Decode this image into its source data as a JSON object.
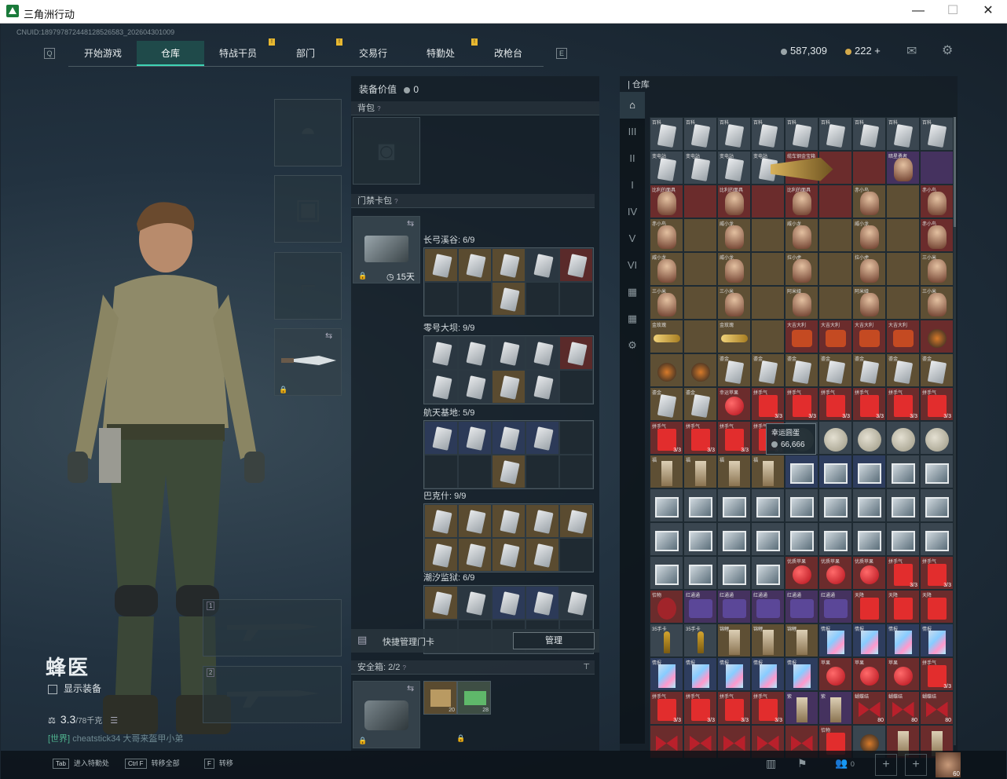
{
  "window": {
    "title": "三角洲行动",
    "minimize": "—",
    "maximize": "☐",
    "close": "✕"
  },
  "uid": "CNUID:189797872448128526583_202604301009",
  "tabs": [
    {
      "label": "开始游戏",
      "warn": false
    },
    {
      "label": "仓库",
      "warn": false
    },
    {
      "label": "特战干员",
      "warn": true
    },
    {
      "label": "部门",
      "warn": true
    },
    {
      "label": "交易行",
      "warn": false
    },
    {
      "label": "特勤处",
      "warn": true
    },
    {
      "label": "改枪台",
      "warn": false
    }
  ],
  "currency": {
    "coins": "587,309",
    "premium": "222 +",
    "coin_color": "#9aa4a8",
    "premium_color": "#d4a94a"
  },
  "operator": {
    "name": "蜂医",
    "show_equipment": "显示装备",
    "weight": "3.3",
    "weight_max": "/78千克"
  },
  "chat": {
    "channel": "[世界]",
    "user": "cheatstick34",
    "message": "大哥来盔甲小弟"
  },
  "equipment": {
    "value_label": "装备价值",
    "value": "0",
    "backpack_label": "背包",
    "card_pack_label": "门禁卡包",
    "card_pack_days": "15天",
    "safe_box_label": "安全箱",
    "safe_box_count": "2/2",
    "quick_manage_label": "快捷管理门卡",
    "manage_button": "管理",
    "safe_item_counts": [
      "20",
      "28"
    ]
  },
  "card_groups": [
    {
      "title": "长弓溪谷: 6/9",
      "tints": [
        "gold",
        "gold",
        "gold",
        "grey",
        "red",
        "",
        "",
        "gold",
        "",
        ""
      ]
    },
    {
      "title": "零号大坝: 9/9",
      "tints": [
        "grey",
        "grey",
        "grey",
        "grey",
        "red",
        "grey",
        "grey",
        "gold",
        "grey",
        ""
      ]
    },
    {
      "title": "航天基地: 5/9",
      "tints": [
        "blue",
        "blue",
        "blue",
        "blue",
        "",
        "",
        "",
        "gold",
        "",
        ""
      ]
    },
    {
      "title": "巴克什: 9/9",
      "tints": [
        "gold",
        "gold",
        "gold",
        "gold",
        "gold",
        "gold",
        "gold",
        "gold",
        "gold",
        ""
      ]
    },
    {
      "title": "潮汐监狱: 6/9",
      "tints": [
        "gold",
        "grey",
        "blue",
        "blue",
        "grey",
        "",
        "",
        "",
        "",
        ""
      ]
    }
  ],
  "warehouse": {
    "label": "仓库",
    "tooltip_title": "幸运圆蛋",
    "tooltip_value": "66,666",
    "sidebar": [
      "⌂",
      "III",
      "II",
      "I",
      "IV",
      "V",
      "VI",
      "▦",
      "▦",
      "⚙",
      "",
      "",
      ""
    ],
    "items": [
      {
        "tint": "grey",
        "shape": "card",
        "label": "百科"
      },
      {
        "tint": "grey",
        "shape": "card",
        "label": "百科"
      },
      {
        "tint": "grey",
        "shape": "card",
        "label": "百科"
      },
      {
        "tint": "grey",
        "shape": "card",
        "label": "百科"
      },
      {
        "tint": "grey",
        "shape": "card",
        "label": "百科"
      },
      {
        "tint": "grey",
        "shape": "card",
        "label": "百科"
      },
      {
        "tint": "grey",
        "shape": "card",
        "label": "百科"
      },
      {
        "tint": "grey",
        "shape": "card",
        "label": "百科"
      },
      {
        "tint": "grey",
        "shape": "card",
        "label": "百科"
      },
      {
        "tint": "grey",
        "shape": "card",
        "label": "变电站"
      },
      {
        "tint": "grey",
        "shape": "card",
        "label": "变电站"
      },
      {
        "tint": "grey",
        "shape": "card",
        "label": "变电站"
      },
      {
        "tint": "grey",
        "shape": "card",
        "label": "变电站"
      },
      {
        "tint": "red",
        "shape": "wide",
        "label": "缆车钢金宝箱"
      },
      {
        "tint": "red",
        "shape": "",
        "label": ""
      },
      {
        "tint": "red",
        "shape": "",
        "label": ""
      },
      {
        "tint": "purple",
        "shape": "doll",
        "label": "暗星勇者"
      },
      {
        "tint": "purple",
        "shape": "",
        "label": ""
      },
      {
        "tint": "red",
        "shape": "doll",
        "label": "比利的面具"
      },
      {
        "tint": "red",
        "shape": "",
        "label": ""
      },
      {
        "tint": "red",
        "shape": "doll",
        "label": "比利的面具"
      },
      {
        "tint": "red",
        "shape": "",
        "label": ""
      },
      {
        "tint": "red",
        "shape": "doll",
        "label": "比利的面具"
      },
      {
        "tint": "red",
        "shape": "",
        "label": ""
      },
      {
        "tint": "gold",
        "shape": "doll",
        "label": "赤小鸟"
      },
      {
        "tint": "gold",
        "shape": "",
        "label": ""
      },
      {
        "tint": "red",
        "shape": "doll",
        "label": "赤小鸟"
      },
      {
        "tint": "gold",
        "shape": "doll",
        "label": "赤小鸟"
      },
      {
        "tint": "gold",
        "shape": "",
        "label": ""
      },
      {
        "tint": "gold",
        "shape": "doll",
        "label": "威小龙"
      },
      {
        "tint": "gold",
        "shape": "",
        "label": ""
      },
      {
        "tint": "gold",
        "shape": "doll",
        "label": "威小龙"
      },
      {
        "tint": "gold",
        "shape": "",
        "label": ""
      },
      {
        "tint": "gold",
        "shape": "doll",
        "label": "威小龙"
      },
      {
        "tint": "gold",
        "shape": "",
        "label": ""
      },
      {
        "tint": "red",
        "shape": "doll",
        "label": "赤小鸟"
      },
      {
        "tint": "gold",
        "shape": "doll",
        "label": "威小龙"
      },
      {
        "tint": "gold",
        "shape": "",
        "label": ""
      },
      {
        "tint": "gold",
        "shape": "doll",
        "label": "威小龙"
      },
      {
        "tint": "gold",
        "shape": "",
        "label": ""
      },
      {
        "tint": "gold",
        "shape": "doll",
        "label": "拉小虎"
      },
      {
        "tint": "gold",
        "shape": "",
        "label": ""
      },
      {
        "tint": "gold",
        "shape": "doll",
        "label": "拉小虎"
      },
      {
        "tint": "gold",
        "shape": "",
        "label": ""
      },
      {
        "tint": "gold",
        "shape": "doll",
        "label": "三小米"
      },
      {
        "tint": "gold",
        "shape": "doll",
        "label": "三小米"
      },
      {
        "tint": "gold",
        "shape": "",
        "label": ""
      },
      {
        "tint": "gold",
        "shape": "doll",
        "label": "三小米"
      },
      {
        "tint": "gold",
        "shape": "",
        "label": ""
      },
      {
        "tint": "gold",
        "shape": "doll",
        "label": "阿米娅"
      },
      {
        "tint": "gold",
        "shape": "",
        "label": ""
      },
      {
        "tint": "gold",
        "shape": "doll",
        "label": "阿米娅"
      },
      {
        "tint": "gold",
        "shape": "",
        "label": ""
      },
      {
        "tint": "gold",
        "shape": "doll",
        "label": "三小米"
      },
      {
        "tint": "gold",
        "shape": "gold",
        "label": "金玫瑰"
      },
      {
        "tint": "gold",
        "shape": "",
        "label": ""
      },
      {
        "tint": "gold",
        "shape": "gold",
        "label": "金玫瑰"
      },
      {
        "tint": "gold",
        "shape": "",
        "label": ""
      },
      {
        "tint": "red",
        "shape": "bag",
        "label": "大吉大利"
      },
      {
        "tint": "red",
        "shape": "bag",
        "label": "大吉大利"
      },
      {
        "tint": "red",
        "shape": "bag",
        "label": "大吉大利"
      },
      {
        "tint": "red",
        "shape": "bag",
        "label": "大吉大利"
      },
      {
        "tint": "red",
        "shape": "dark",
        "label": ""
      },
      {
        "tint": "gold",
        "shape": "dark",
        "label": ""
      },
      {
        "tint": "gold",
        "shape": "dark",
        "label": ""
      },
      {
        "tint": "gold",
        "shape": "card",
        "label": "鎏金"
      },
      {
        "tint": "gold",
        "shape": "card",
        "label": "鎏金"
      },
      {
        "tint": "gold",
        "shape": "card",
        "label": "鎏金"
      },
      {
        "tint": "gold",
        "shape": "card",
        "label": "鎏金"
      },
      {
        "tint": "gold",
        "shape": "card",
        "label": "鎏金"
      },
      {
        "tint": "gold",
        "shape": "card",
        "label": "鎏金"
      },
      {
        "tint": "gold",
        "shape": "card",
        "label": "鎏金"
      },
      {
        "tint": "gold",
        "shape": "card",
        "label": "鎏金"
      },
      {
        "tint": "gold",
        "shape": "card",
        "label": "鎏金"
      },
      {
        "tint": "red",
        "shape": "apple",
        "label": "幸运苹果"
      },
      {
        "tint": "red",
        "shape": "env",
        "label": "拼手气",
        "count": "3/3"
      },
      {
        "tint": "red",
        "shape": "env",
        "label": "拼手气",
        "count": "3/3"
      },
      {
        "tint": "red",
        "shape": "env",
        "label": "拼手气",
        "count": "3/3"
      },
      {
        "tint": "red",
        "shape": "env",
        "label": "拼手气",
        "count": "3/3"
      },
      {
        "tint": "red",
        "shape": "env",
        "label": "拼手气",
        "count": "3/3"
      },
      {
        "tint": "red",
        "shape": "env",
        "label": "拼手气",
        "count": "3/3"
      },
      {
        "tint": "red",
        "shape": "env",
        "label": "拼手气",
        "count": "3/3"
      },
      {
        "tint": "red",
        "shape": "env",
        "label": "拼手气",
        "count": "3/3"
      },
      {
        "tint": "red",
        "shape": "env",
        "label": "拼手气",
        "count": "3/3"
      },
      {
        "tint": "red",
        "shape": "env",
        "label": "拼手气",
        "count": "3/3"
      },
      {
        "tint": "grey",
        "shape": "moon",
        "label": ""
      },
      {
        "tint": "grey",
        "shape": "moon",
        "label": ""
      },
      {
        "tint": "grey",
        "shape": "moon",
        "label": ""
      },
      {
        "tint": "grey",
        "shape": "moon",
        "label": ""
      },
      {
        "tint": "grey",
        "shape": "moon",
        "label": ""
      },
      {
        "tint": "gold",
        "shape": "strip",
        "label": "福"
      },
      {
        "tint": "gold",
        "shape": "strip",
        "label": "福"
      },
      {
        "tint": "gold",
        "shape": "strip",
        "label": "福"
      },
      {
        "tint": "gold",
        "shape": "strip",
        "label": "福"
      },
      {
        "tint": "blue",
        "shape": "photo",
        "label": ""
      },
      {
        "tint": "blue",
        "shape": "photo",
        "label": ""
      },
      {
        "tint": "blue",
        "shape": "photo",
        "label": ""
      },
      {
        "tint": "grey",
        "shape": "photo",
        "label": ""
      },
      {
        "tint": "grey",
        "shape": "photo",
        "label": ""
      },
      {
        "tint": "grey",
        "shape": "photo",
        "label": ""
      },
      {
        "tint": "grey",
        "shape": "photo",
        "label": ""
      },
      {
        "tint": "grey",
        "shape": "photo",
        "label": ""
      },
      {
        "tint": "grey",
        "shape": "photo",
        "label": ""
      },
      {
        "tint": "grey",
        "shape": "photo",
        "label": ""
      },
      {
        "tint": "grey",
        "shape": "photo",
        "label": ""
      },
      {
        "tint": "grey",
        "shape": "photo",
        "label": ""
      },
      {
        "tint": "grey",
        "shape": "photo",
        "label": ""
      },
      {
        "tint": "grey",
        "shape": "photo",
        "label": ""
      },
      {
        "tint": "grey",
        "shape": "photo",
        "label": ""
      },
      {
        "tint": "grey",
        "shape": "photo",
        "label": ""
      },
      {
        "tint": "grey",
        "shape": "photo",
        "label": ""
      },
      {
        "tint": "grey",
        "shape": "photo",
        "label": ""
      },
      {
        "tint": "grey",
        "shape": "photo",
        "label": ""
      },
      {
        "tint": "grey",
        "shape": "photo",
        "label": ""
      },
      {
        "tint": "grey",
        "shape": "photo",
        "label": ""
      },
      {
        "tint": "grey",
        "shape": "photo",
        "label": ""
      },
      {
        "tint": "grey",
        "shape": "photo",
        "label": ""
      },
      {
        "tint": "grey",
        "shape": "photo",
        "label": ""
      },
      {
        "tint": "grey",
        "shape": "photo",
        "label": ""
      },
      {
        "tint": "grey",
        "shape": "photo",
        "label": ""
      },
      {
        "tint": "grey",
        "shape": "photo",
        "label": ""
      },
      {
        "tint": "red",
        "shape": "apple",
        "label": "优质苹果"
      },
      {
        "tint": "red",
        "shape": "apple",
        "label": "优质苹果"
      },
      {
        "tint": "red",
        "shape": "apple",
        "label": "优质苹果"
      },
      {
        "tint": "red",
        "shape": "env",
        "label": "拼手气",
        "count": "3/3"
      },
      {
        "tint": "red",
        "shape": "env",
        "label": "拼手气",
        "count": "3/3"
      },
      {
        "tint": "red",
        "shape": "mask",
        "label": "恰物"
      },
      {
        "tint": "purple",
        "shape": "purple",
        "label": "红通通"
      },
      {
        "tint": "purple",
        "shape": "purple",
        "label": "红通通"
      },
      {
        "tint": "purple",
        "shape": "purple",
        "label": "红通通"
      },
      {
        "tint": "purple",
        "shape": "purple",
        "label": "红通通"
      },
      {
        "tint": "purple",
        "shape": "purple",
        "label": "红通通"
      },
      {
        "tint": "red",
        "shape": "env",
        "label": "天降"
      },
      {
        "tint": "red",
        "shape": "env",
        "label": "天降"
      },
      {
        "tint": "red",
        "shape": "env",
        "label": "天降"
      },
      {
        "tint": "grey",
        "shape": "bullet",
        "label": "35手卡"
      },
      {
        "tint": "grey",
        "shape": "bullet",
        "label": "35手卡"
      },
      {
        "tint": "gold",
        "shape": "strip",
        "label": "锦鲤"
      },
      {
        "tint": "gold",
        "shape": "strip",
        "label": "锦鲤"
      },
      {
        "tint": "gold",
        "shape": "strip",
        "label": "锦鲤"
      },
      {
        "tint": "blue",
        "shape": "holo",
        "label": "情报"
      },
      {
        "tint": "blue",
        "shape": "holo",
        "label": "情报"
      },
      {
        "tint": "blue",
        "shape": "holo",
        "label": "情报"
      },
      {
        "tint": "blue",
        "shape": "holo",
        "label": "情报"
      },
      {
        "tint": "blue",
        "shape": "holo",
        "label": "情报"
      },
      {
        "tint": "blue",
        "shape": "holo",
        "label": "情报"
      },
      {
        "tint": "blue",
        "shape": "holo",
        "label": "情报"
      },
      {
        "tint": "blue",
        "shape": "holo",
        "label": "情报"
      },
      {
        "tint": "blue",
        "shape": "holo",
        "label": "情报"
      },
      {
        "tint": "red",
        "shape": "apple",
        "label": "苹果"
      },
      {
        "tint": "red",
        "shape": "apple",
        "label": "苹果"
      },
      {
        "tint": "red",
        "shape": "apple",
        "label": "苹果"
      },
      {
        "tint": "red",
        "shape": "env",
        "label": "拼手气",
        "count": "3/3"
      },
      {
        "tint": "red",
        "shape": "env",
        "label": "拼手气",
        "count": "3/3"
      },
      {
        "tint": "red",
        "shape": "env",
        "label": "拼手气",
        "count": "3/3"
      },
      {
        "tint": "red",
        "shape": "env",
        "label": "拼手气",
        "count": "3/3"
      },
      {
        "tint": "red",
        "shape": "env",
        "label": "拼手气",
        "count": "3/3"
      },
      {
        "tint": "purple",
        "shape": "strip",
        "label": "紫"
      },
      {
        "tint": "purple",
        "shape": "strip",
        "label": "紫"
      },
      {
        "tint": "red",
        "shape": "bow",
        "label": "蝴蝶结",
        "count": "80"
      },
      {
        "tint": "red",
        "shape": "bow",
        "label": "蝴蝶结",
        "count": "80"
      },
      {
        "tint": "red",
        "shape": "bow",
        "label": "蝴蝶结",
        "count": "80"
      },
      {
        "tint": "red",
        "shape": "bow",
        "label": ""
      },
      {
        "tint": "red",
        "shape": "bow",
        "label": ""
      },
      {
        "tint": "red",
        "shape": "bow",
        "label": ""
      },
      {
        "tint": "red",
        "shape": "bow",
        "label": ""
      },
      {
        "tint": "red",
        "shape": "bow",
        "label": ""
      },
      {
        "tint": "red",
        "shape": "env",
        "label": "恰物"
      },
      {
        "tint": "grey",
        "shape": "dark",
        "label": ""
      },
      {
        "tint": "red",
        "shape": "strip",
        "label": ""
      },
      {
        "tint": "red",
        "shape": "strip",
        "label": ""
      }
    ]
  },
  "bottom": {
    "keys": [
      {
        "key": "Tab",
        "label": "进入特勤处"
      },
      {
        "key": "Ctrl F",
        "label": "转移全部"
      },
      {
        "key": "F",
        "label": "转移"
      }
    ],
    "friends_count": "0",
    "avatar_level": "60"
  }
}
